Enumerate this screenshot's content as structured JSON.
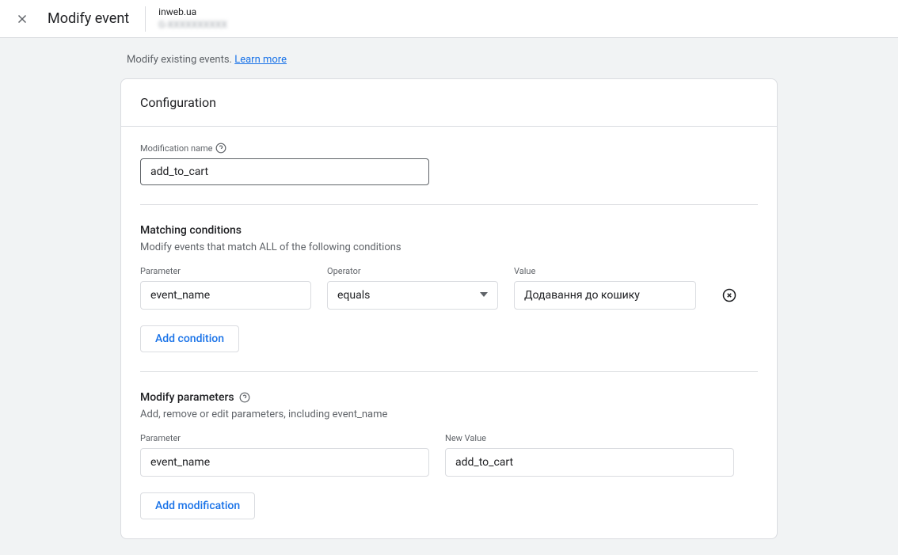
{
  "header": {
    "title": "Modify event",
    "property_name": "inweb.ua",
    "property_id": "G-XXXXXXXXXX"
  },
  "intro": {
    "text": "Modify existing events.",
    "link_label": "Learn more"
  },
  "card": {
    "title": "Configuration"
  },
  "modification_name": {
    "label": "Modification name",
    "value": "add_to_cart"
  },
  "matching": {
    "title": "Matching conditions",
    "description": "Modify events that match ALL of the following conditions",
    "labels": {
      "parameter": "Parameter",
      "operator": "Operator",
      "value": "Value"
    },
    "rows": [
      {
        "parameter": "event_name",
        "operator": "equals",
        "value": "Додавання до кошику"
      }
    ],
    "add_button": "Add condition"
  },
  "modify_params": {
    "title": "Modify parameters",
    "description": "Add, remove or edit parameters, including event_name",
    "labels": {
      "parameter": "Parameter",
      "new_value": "New Value"
    },
    "rows": [
      {
        "parameter": "event_name",
        "new_value": "add_to_cart"
      }
    ],
    "add_button": "Add modification"
  }
}
